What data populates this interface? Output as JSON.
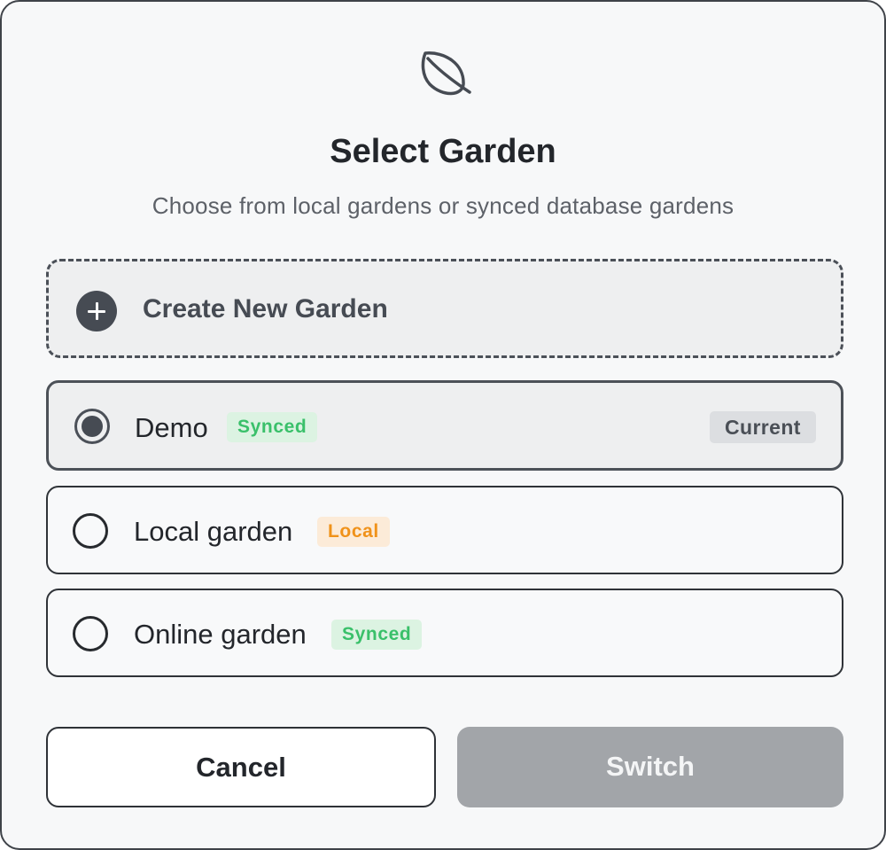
{
  "dialog": {
    "icon": "leaf-icon",
    "title": "Select Garden",
    "subtitle": "Choose from local gardens or synced database gardens"
  },
  "create_new": {
    "icon": "plus-circle-icon",
    "label": "Create New Garden"
  },
  "gardens": [
    {
      "name": "Demo",
      "badge": "Synced",
      "badge_type": "synced",
      "selected": true,
      "current_label": "Current"
    },
    {
      "name": "Local garden",
      "badge": "Local",
      "badge_type": "local",
      "selected": false
    },
    {
      "name": "Online garden",
      "badge": "Synced",
      "badge_type": "synced",
      "selected": false
    }
  ],
  "actions": {
    "cancel_label": "Cancel",
    "switch_label": "Switch",
    "switch_enabled": false
  },
  "colors": {
    "synced_badge_text": "#3ac06a",
    "synced_badge_bg": "#dcf3e2",
    "local_badge_text": "#f0921a",
    "local_badge_bg": "#fcebd8",
    "primary_dark": "#464b53",
    "disabled_button": "#a2a5a9"
  }
}
